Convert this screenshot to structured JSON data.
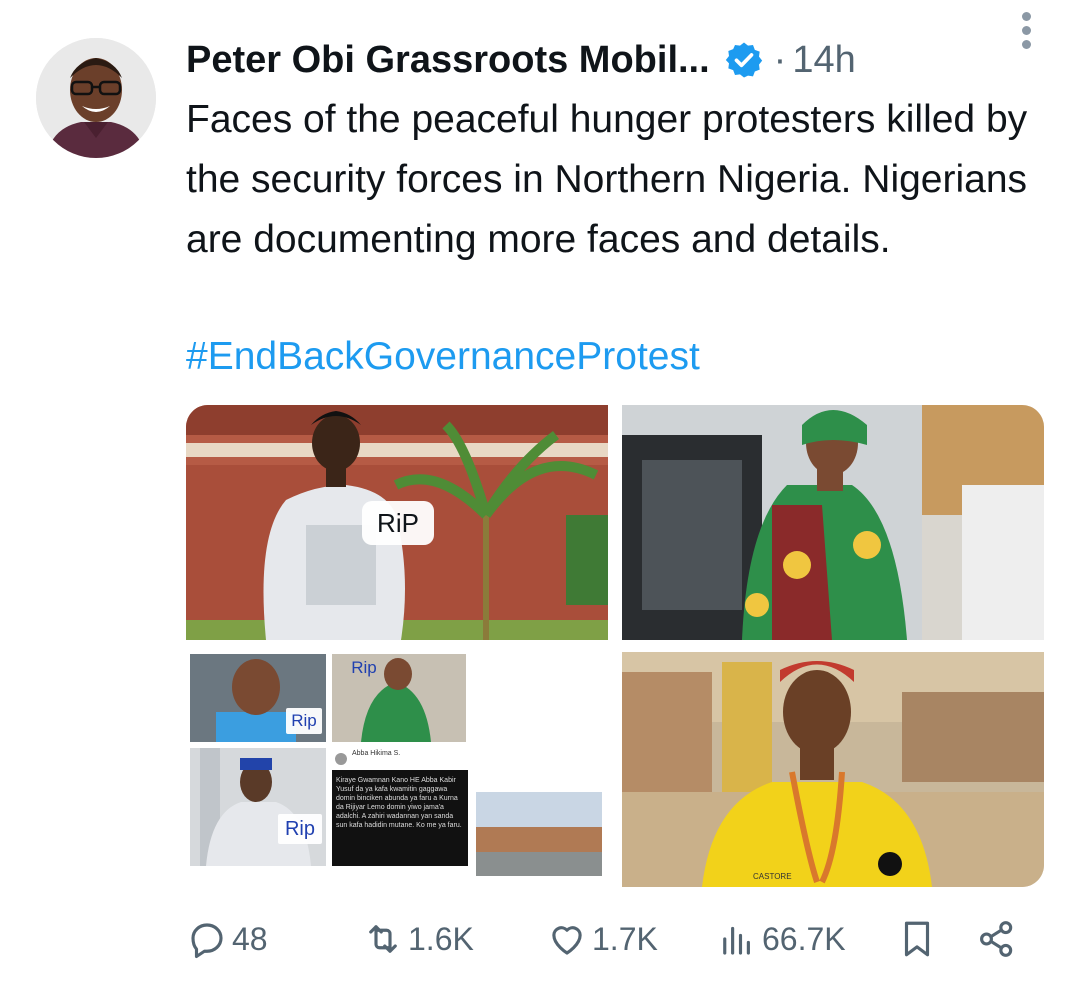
{
  "tweet": {
    "author_name": "Peter Obi Grassroots Mobil...",
    "separator": "·",
    "time": "14h",
    "text": "Faces of the peaceful hunger protesters killed by the security forces in Northern Nigeria. Nigerians are documenting more faces and details.",
    "hashtag": "#EndBackGovernanceProtest"
  },
  "media": {
    "image1_tag": "RiP",
    "image3_tags": [
      "Rip",
      "Rip",
      "Rip"
    ],
    "image3_post_author": "Abba Hikima S.",
    "image3_post_text": "Kiraye Gwamnan Kano HE Abba Kabir Yusuf da ya kafa kwamitin gaggawa domin binciken abunda ya faru a Kurna da Rijiyar Lemo domin yiwo jama'a adalchi. A zahiri wadannan yan sanda sun kafa hadidin mutane. Ko me ya faru.",
    "image4_shirt_text": "CASTORE"
  },
  "actions": {
    "replies": "48",
    "reposts": "1.6K",
    "likes": "1.7K",
    "views": "66.7K"
  },
  "colors": {
    "accent": "#1d9bf0",
    "muted": "#536471",
    "text": "#0f1419"
  }
}
